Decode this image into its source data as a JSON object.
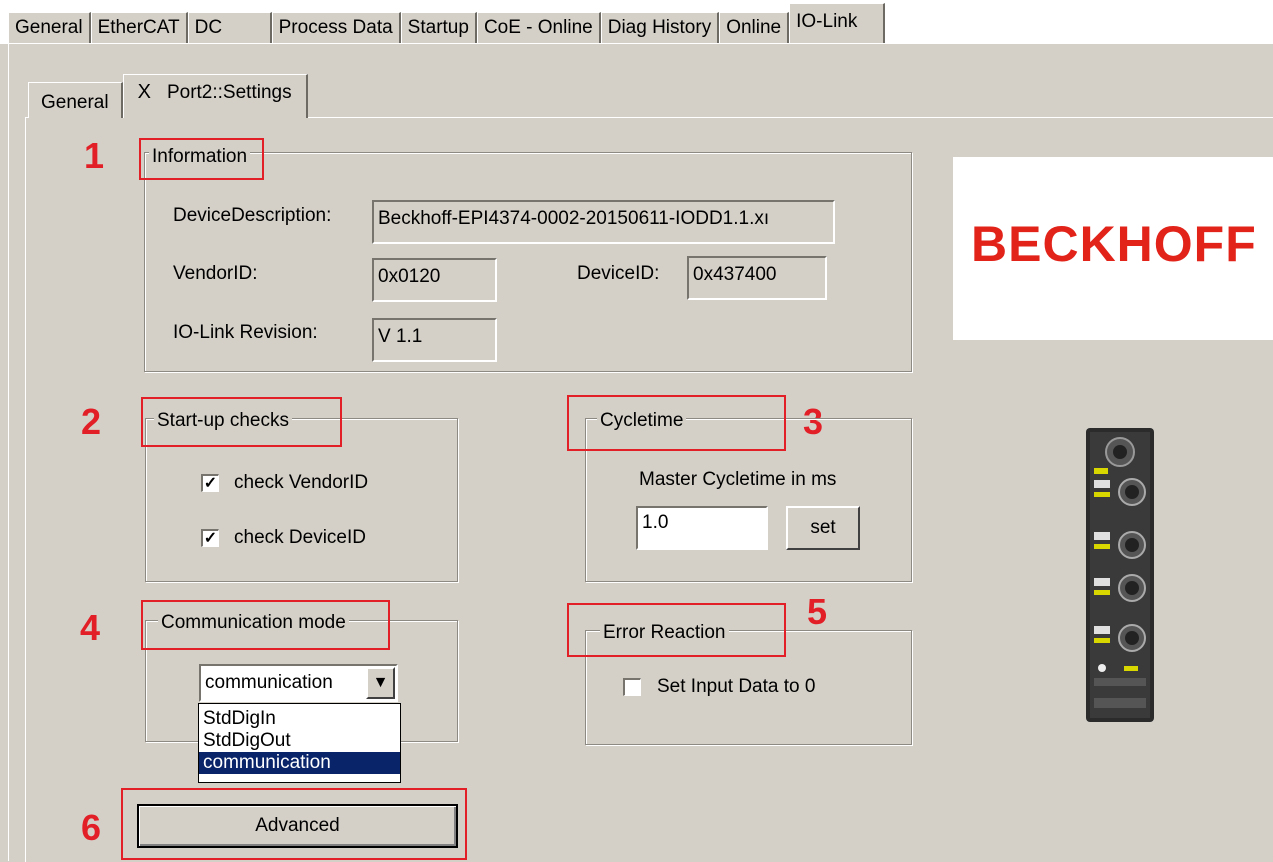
{
  "top_tabs": [
    "General",
    "EtherCAT",
    "DC",
    "Process Data",
    "Startup",
    "CoE - Online",
    "Diag History",
    "Online",
    "IO-Link"
  ],
  "sub_tabs": {
    "general": "General",
    "close_glyph": "X",
    "settings": "Port2::Settings"
  },
  "markers": [
    "1",
    "2",
    "3",
    "4",
    "5",
    "6"
  ],
  "information": {
    "legend": "Information",
    "device_description_label": "DeviceDescription:",
    "device_description_value": "Beckhoff-EPI4374-0002-20150611-IODD1.1.xı",
    "vendor_id_label": "VendorID:",
    "vendor_id_value": "0x0120",
    "device_id_label": "DeviceID:",
    "device_id_value": "0x437400",
    "revision_label": "IO-Link Revision:",
    "revision_value": "V 1.1"
  },
  "startup_checks": {
    "legend": "Start-up checks",
    "check_vendor": {
      "label": "check VendorID",
      "checked": true
    },
    "check_device": {
      "label": "check DeviceID",
      "checked": true
    }
  },
  "cycletime": {
    "legend": "Cycletime",
    "label": "Master Cycletime in ms",
    "value": "1.0",
    "set_button": "set"
  },
  "communication_mode": {
    "legend": "Communication mode",
    "selected": "communication",
    "options": [
      "StdDigIn",
      "StdDigOut",
      "communication"
    ]
  },
  "error_reaction": {
    "legend": "Error Reaction",
    "set_input_zero": {
      "label": "Set Input Data to 0",
      "checked": false
    }
  },
  "advanced_button": "Advanced",
  "logo_text": "BECKHOFF",
  "colors": {
    "annotation_red": "#e21f26",
    "logo_red": "#e2231a",
    "selection_blue": "#0a246a",
    "panel_gray": "#d4d0c8"
  }
}
